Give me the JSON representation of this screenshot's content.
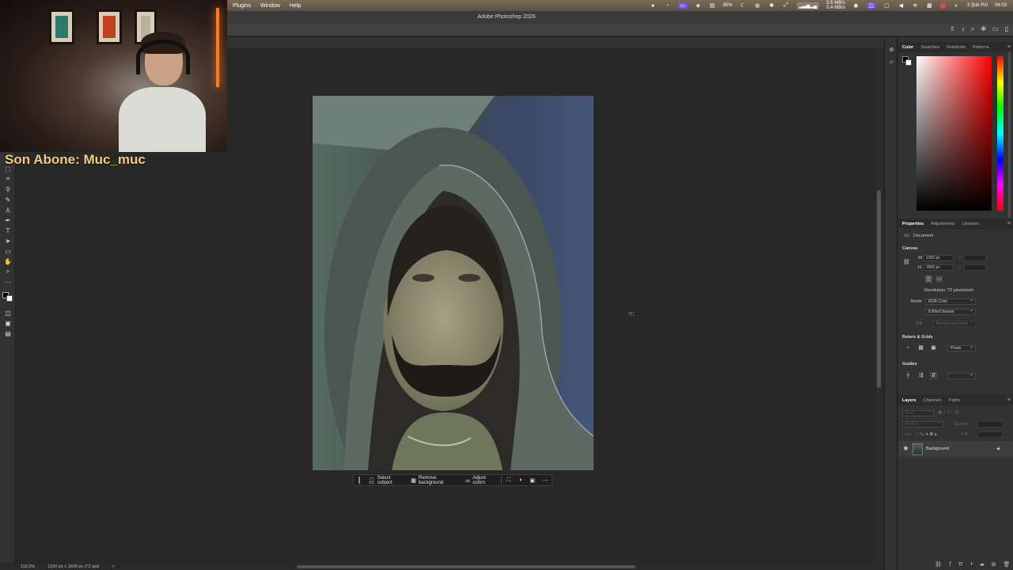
{
  "menubar": {
    "menus": [
      "Plugins",
      "Window",
      "Help"
    ],
    "battery": "85%",
    "network_up": "0.5 MB/s",
    "network_down": "0.4 MB/s",
    "date": "2 Şub Pzt",
    "time": "04:03"
  },
  "app": {
    "title": "Adobe Photoshop 2026"
  },
  "stream": {
    "last_subscriber": "Son Abone: Muc_muc"
  },
  "taskbar": {
    "select_subject": "Select subject",
    "remove_background": "Remove background",
    "adjust_colors": "Adjust colors"
  },
  "statusbar": {
    "zoom": "118,3%",
    "doc_info": "1200 px x 1600 px (72 ppi)",
    "arrow": ">"
  },
  "color_panel": {
    "tabs": [
      "Color",
      "Swatches",
      "Gradients",
      "Patterns"
    ],
    "foreground": "#000000",
    "background": "#ffffff"
  },
  "properties": {
    "tabs": [
      "Properties",
      "Adjustments",
      "Libraries"
    ],
    "document_label": "Document",
    "canvas_section": "Canvas",
    "width_label": "W",
    "width_value": "1200 px",
    "height_label": "H",
    "height_value": "1600 px",
    "x_label": "X",
    "y_label": "Y",
    "resolution": "Resolution: 72 pixels/inch",
    "mode_label": "Mode",
    "mode_value": "RGB Color",
    "bit_depth": "8 Bits/Channel",
    "fill_label": "Fill",
    "fill_value": "Background Color",
    "rulers_section": "Rulers & Grids",
    "units_value": "Pixels",
    "guides_section": "Guides"
  },
  "layers": {
    "tabs": [
      "Layers",
      "Channels",
      "Paths"
    ],
    "kind_label": "Kind",
    "blend_mode": "Normal",
    "opacity_label": "Opacity:",
    "lock_label": "Lock:",
    "fill_label": "Fill:",
    "layer_name": "Background"
  }
}
